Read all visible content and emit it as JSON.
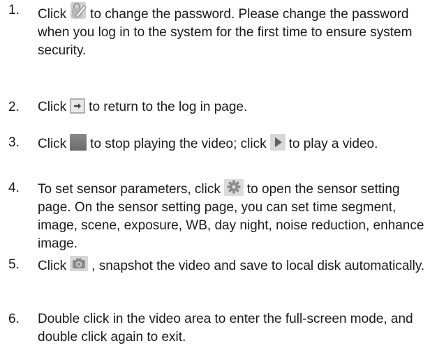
{
  "items": [
    {
      "number": "1.",
      "before": "Click",
      "icon": "password-edit-icon",
      "after": "to change the password. Please change the password when you log in to the system for the first time to ensure system security."
    },
    {
      "number": "2.",
      "before": "Click",
      "icon": "logout-icon",
      "after": "to return to the log in page."
    },
    {
      "number": "3.",
      "before": "Click",
      "icon": "stop-icon",
      "middle": "to stop playing the video; click",
      "icon2": "play-icon",
      "after": "to play a video."
    },
    {
      "number": "4.",
      "before": "To set sensor parameters, click",
      "icon": "gear-icon",
      "after": "to open the sensor setting page. On the sensor setting page, you can set time segment, image, scene, exposure, WB, day night, noise reduction, enhance image."
    },
    {
      "number": "5.",
      "before": "Click",
      "icon": "camera-icon",
      "after": ", snapshot the video and save to local disk automatically."
    },
    {
      "number": "6.",
      "text": "Double click in the video area to enter the full-screen mode, and double click again to exit."
    }
  ],
  "colors": {
    "text": "#1a1a1a",
    "icon_gray": "#8a8a8a"
  }
}
